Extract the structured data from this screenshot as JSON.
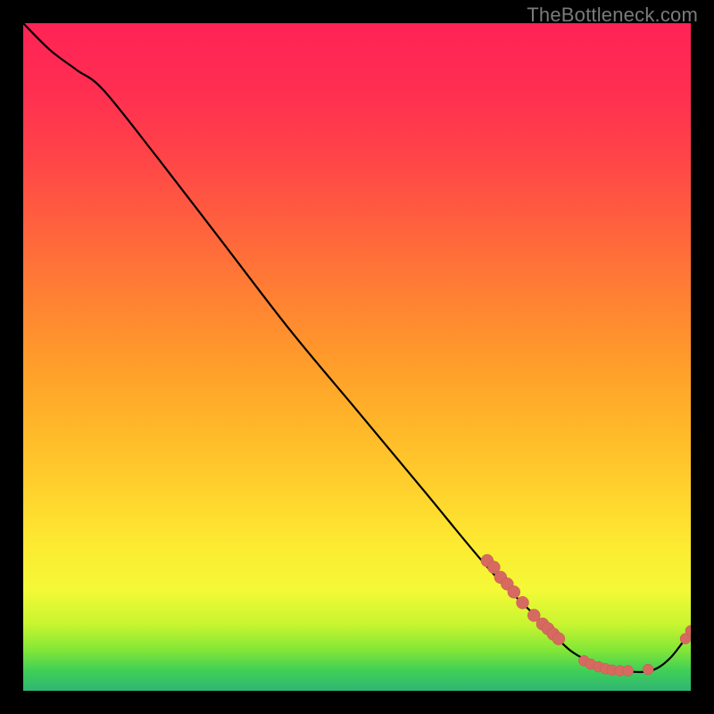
{
  "watermark": "TheBottleneck.com",
  "chart_data": {
    "type": "line",
    "title": "",
    "xlabel": "",
    "ylabel": "",
    "xlim": [
      0,
      100
    ],
    "ylim": [
      0,
      100
    ],
    "grid": false,
    "series": [
      {
        "name": "curve",
        "x": [
          0,
          4,
          8,
          12,
          20,
          30,
          40,
          50,
          60,
          70,
          78,
          82,
          86,
          90,
          94,
          97,
          100
        ],
        "y": [
          100,
          96,
          93,
          90,
          80,
          67,
          54,
          42,
          30,
          18,
          10,
          6,
          4,
          3,
          3,
          5,
          9
        ]
      }
    ],
    "points_overlay": [
      {
        "x": 69.5,
        "y": 19.5,
        "r": 7
      },
      {
        "x": 70.5,
        "y": 18.5,
        "r": 7
      },
      {
        "x": 71.5,
        "y": 17.0,
        "r": 7
      },
      {
        "x": 72.5,
        "y": 16.0,
        "r": 7
      },
      {
        "x": 73.5,
        "y": 14.8,
        "r": 7
      },
      {
        "x": 74.8,
        "y": 13.2,
        "r": 7
      },
      {
        "x": 76.5,
        "y": 11.3,
        "r": 7
      },
      {
        "x": 77.8,
        "y": 10.0,
        "r": 7
      },
      {
        "x": 78.6,
        "y": 9.3,
        "r": 7
      },
      {
        "x": 79.4,
        "y": 8.5,
        "r": 7
      },
      {
        "x": 80.2,
        "y": 7.8,
        "r": 7
      },
      {
        "x": 84.0,
        "y": 4.5,
        "r": 6
      },
      {
        "x": 85.0,
        "y": 4.0,
        "r": 6
      },
      {
        "x": 86.2,
        "y": 3.6,
        "r": 6
      },
      {
        "x": 87.2,
        "y": 3.3,
        "r": 6
      },
      {
        "x": 88.2,
        "y": 3.1,
        "r": 6
      },
      {
        "x": 89.4,
        "y": 3.0,
        "r": 6
      },
      {
        "x": 90.6,
        "y": 3.0,
        "r": 6
      },
      {
        "x": 93.6,
        "y": 3.2,
        "r": 6
      },
      {
        "x": 99.2,
        "y": 7.8,
        "r": 6
      },
      {
        "x": 100.0,
        "y": 9.0,
        "r": 6
      }
    ],
    "colors": {
      "curve": "#000000",
      "points": "#d66a60",
      "gradient_top": "#ff2356",
      "gradient_bottom": "#2fb673"
    }
  }
}
